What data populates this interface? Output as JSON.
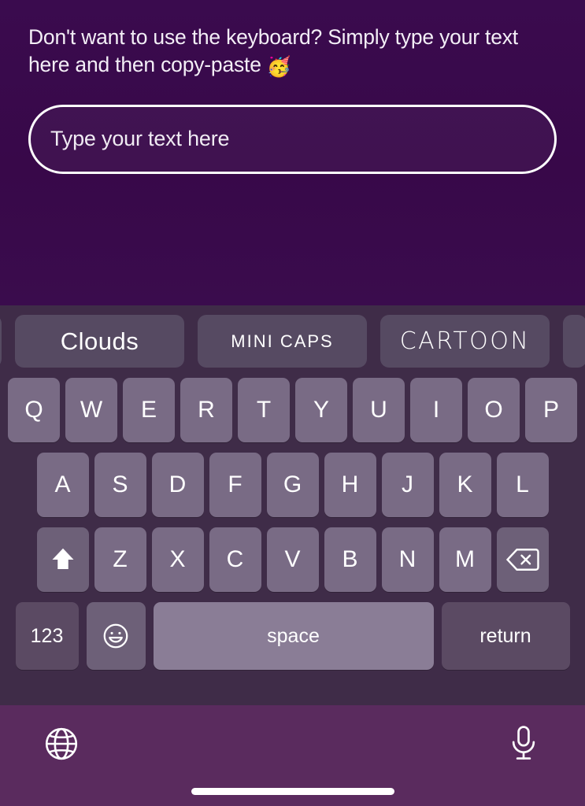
{
  "app": {
    "prompt": "Don't want to use the keyboard? Simply type your text here and then copy-paste ",
    "prompt_emoji": "🥳",
    "input": {
      "value": "",
      "placeholder": "Type your text here"
    }
  },
  "keyboard": {
    "style_chips": [
      {
        "label": "",
        "name": "style-chip-partial-left"
      },
      {
        "label": "Clouds",
        "name": "style-chip-clouds"
      },
      {
        "label": "MINI CAPS",
        "name": "style-chip-mini-caps"
      },
      {
        "label": "CARTOON",
        "name": "style-chip-cartoon"
      },
      {
        "label": "",
        "name": "style-chip-partial-right"
      }
    ],
    "row1": [
      "Q",
      "W",
      "E",
      "R",
      "T",
      "Y",
      "U",
      "I",
      "O",
      "P"
    ],
    "row2": [
      "A",
      "S",
      "D",
      "F",
      "G",
      "H",
      "J",
      "K",
      "L"
    ],
    "row3": [
      "Z",
      "X",
      "C",
      "V",
      "B",
      "N",
      "M"
    ],
    "shift_icon": "shift-arrow-up-icon",
    "backspace_icon": "backspace-delete-icon",
    "bottom_row": {
      "numbers_label": "123",
      "emoji_icon": "emoji-smiley-icon",
      "space_label": "space",
      "return_label": "return"
    }
  },
  "bottom_bar": {
    "globe_icon": "globe-language-icon",
    "mic_icon": "microphone-dictation-icon",
    "home_indicator": "home-indicator-bar"
  },
  "colors": {
    "app_background": "#38084a",
    "keyboard_background": "#3f2c48",
    "key_fill": "#796b85",
    "key_fill_dark": "#5b4a63",
    "space_fill": "#8a7d96",
    "chip_fill": "#564a62",
    "bottom_bar": "#5a2b5e",
    "text": "#ffffff"
  }
}
